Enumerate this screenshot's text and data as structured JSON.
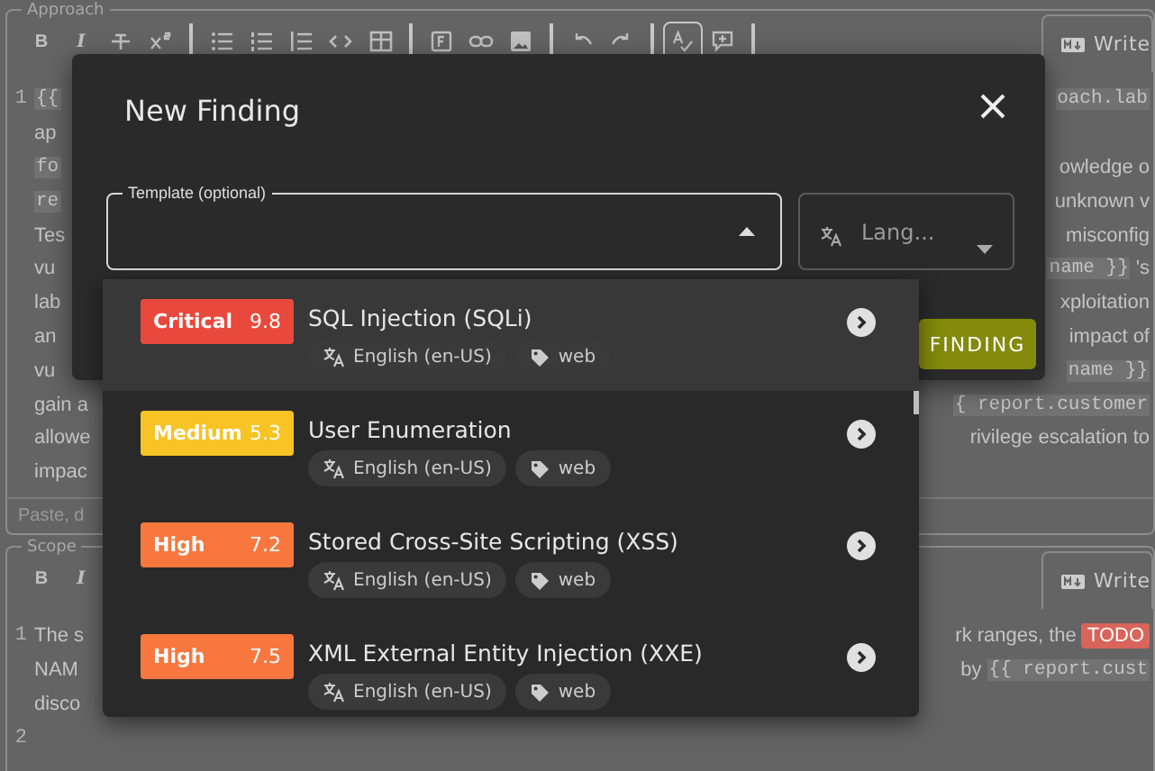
{
  "approach": {
    "legend": "Approach",
    "toolbar": [
      {
        "kind": "bold",
        "label": "B"
      },
      {
        "kind": "italic",
        "label": "I"
      },
      {
        "kind": "strike"
      },
      {
        "kind": "superscript"
      },
      {
        "kind": "divider"
      },
      {
        "kind": "bullets"
      },
      {
        "kind": "numbers"
      },
      {
        "kind": "steps"
      },
      {
        "kind": "code"
      },
      {
        "kind": "table"
      },
      {
        "kind": "divider"
      },
      {
        "kind": "figure"
      },
      {
        "kind": "link"
      },
      {
        "kind": "image"
      },
      {
        "kind": "divider"
      },
      {
        "kind": "undo"
      },
      {
        "kind": "redo"
      },
      {
        "kind": "divider"
      },
      {
        "kind": "spellcheck",
        "selected": true
      },
      {
        "kind": "comment"
      },
      {
        "kind": "divider"
      }
    ],
    "preview_tab": "Write",
    "lines": [
      {
        "number": "1",
        "left": [
          {
            "text": "{{",
            "kind": "code"
          }
        ],
        "right": [
          {
            "text": "oach.lab",
            "kind": "code"
          }
        ]
      },
      {
        "left": [
          {
            "text": "ap",
            "kind": "text"
          }
        ]
      },
      {
        "left": [
          {
            "text": "fo",
            "kind": "code"
          }
        ],
        "right": [
          {
            "text": "owledge o",
            "kind": "text"
          }
        ]
      },
      {
        "left": [
          {
            "text": "re",
            "kind": "code"
          }
        ],
        "right": [
          {
            "text": "unknown v",
            "kind": "text"
          }
        ]
      },
      {
        "left": [
          {
            "text": "Tes",
            "kind": "text"
          }
        ],
        "right": [
          {
            "text": "misconfig",
            "kind": "text"
          }
        ]
      },
      {
        "left": [
          {
            "text": "vu",
            "kind": "text"
          }
        ],
        "right": [
          {
            "text": "name }}",
            "kind": "code"
          },
          {
            "text": "'s",
            "kind": "text"
          }
        ]
      },
      {
        "left": [
          {
            "text": "lab",
            "kind": "text"
          }
        ],
        "right": [
          {
            "text": "xploitation",
            "kind": "text"
          }
        ]
      },
      {
        "left": [
          {
            "text": "an",
            "kind": "text"
          }
        ],
        "right": [
          {
            "text": "impact of",
            "kind": "text"
          }
        ]
      },
      {
        "left": [
          {
            "text": "vu",
            "kind": "text"
          }
        ],
        "right": [
          {
            "text": "name }}",
            "kind": "code"
          }
        ]
      },
      {
        "left": [
          {
            "text": "gain a",
            "kind": "text"
          }
        ],
        "right": [
          {
            "text": "{ report.customer",
            "kind": "code"
          }
        ]
      },
      {
        "left": [
          {
            "text": "allowe",
            "kind": "text"
          }
        ],
        "right": [
          {
            "text": "rivilege escalation to",
            "kind": "text"
          }
        ]
      },
      {
        "left": [
          {
            "text": "impac",
            "kind": "text"
          }
        ]
      }
    ],
    "footer_placeholder": "Paste, d"
  },
  "scope": {
    "legend": "Scope",
    "toolbar": [
      {
        "kind": "bold",
        "label": "B"
      },
      {
        "kind": "italic",
        "label": "I"
      }
    ],
    "preview_tab": "Write",
    "lines": [
      {
        "number": "1",
        "left": [
          {
            "text": "The s",
            "kind": "text"
          }
        ],
        "right": [
          {
            "text": "rk ranges, the",
            "kind": "text"
          },
          {
            "text": "TODO",
            "kind": "todo"
          }
        ]
      },
      {
        "left": [
          {
            "text": "NAM",
            "kind": "text"
          }
        ],
        "right": [
          {
            "text": "by",
            "kind": "text"
          },
          {
            "text": "{{ report.cust",
            "kind": "code"
          }
        ]
      },
      {
        "left": [
          {
            "text": "disco",
            "kind": "text"
          }
        ]
      },
      {
        "number": "2"
      }
    ]
  },
  "dialog": {
    "title": "New Finding",
    "template_field": {
      "label": "Template (optional)",
      "expanded": true
    },
    "language_field": {
      "placeholder": "Lang..."
    },
    "button": "FINDING"
  },
  "templates": [
    {
      "severity": "Critical",
      "score": "9.8",
      "color": "#e9493d",
      "title": "SQL Injection (SQLi)",
      "language": "English (en-US)",
      "tags": [
        "web"
      ],
      "highlighted": true
    },
    {
      "severity": "Medium",
      "score": "5.3",
      "color": "#f7c325",
      "title": "User Enumeration",
      "language": "English (en-US)",
      "tags": [
        "web"
      ],
      "highlighted": false
    },
    {
      "severity": "High",
      "score": "7.2",
      "color": "#f8773e",
      "title": "Stored Cross-Site Scripting (XSS)",
      "language": "English (en-US)",
      "tags": [
        "web"
      ],
      "highlighted": false
    },
    {
      "severity": "High",
      "score": "7.5",
      "color": "#f8773e",
      "title": "XML External Entity Injection (XXE)",
      "language": "English (en-US)",
      "tags": [
        "web"
      ],
      "highlighted": false
    }
  ]
}
